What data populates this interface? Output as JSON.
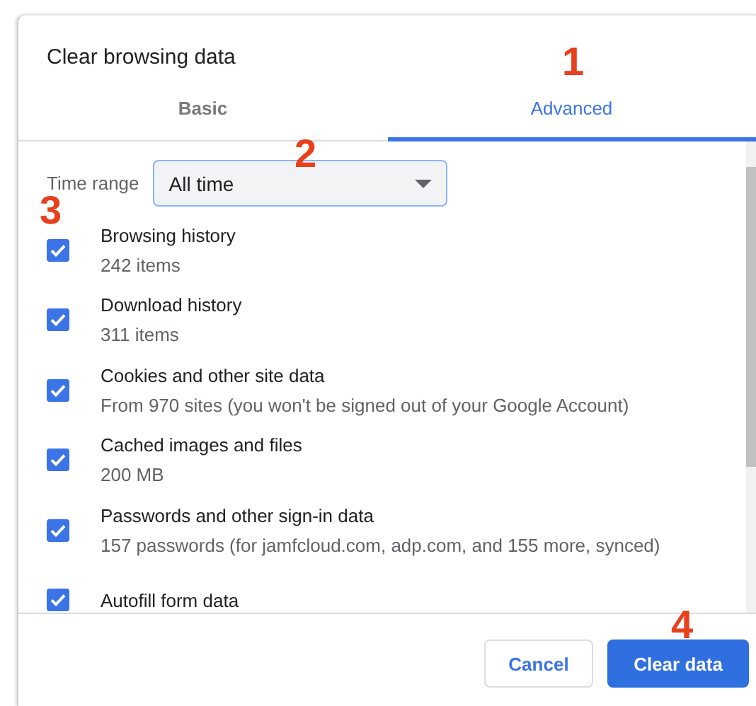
{
  "dialog": {
    "title": "Clear browsing data"
  },
  "tabs": [
    {
      "label": "Basic",
      "selected": false
    },
    {
      "label": "Advanced",
      "selected": true
    }
  ],
  "time_range": {
    "label": "Time range",
    "value": "All time"
  },
  "items": [
    {
      "label": "Browsing history",
      "detail": "242 items",
      "checked": true
    },
    {
      "label": "Download history",
      "detail": "311 items",
      "checked": true
    },
    {
      "label": "Cookies and other site data",
      "detail": "From 970 sites (you won't be signed out of your Google Account)",
      "checked": true
    },
    {
      "label": "Cached images and files",
      "detail": "200 MB",
      "checked": true
    },
    {
      "label": "Passwords and other sign-in data",
      "detail": "157 passwords (for jamfcloud.com, adp.com, and 155 more, synced)",
      "checked": true
    },
    {
      "label": "Autofill form data",
      "checked": true
    }
  ],
  "buttons": [
    {
      "label": "Cancel",
      "kind": "secondary"
    },
    {
      "label": "Clear data",
      "kind": "primary"
    }
  ],
  "annotations": [
    "1",
    "2",
    "3",
    "4"
  ]
}
